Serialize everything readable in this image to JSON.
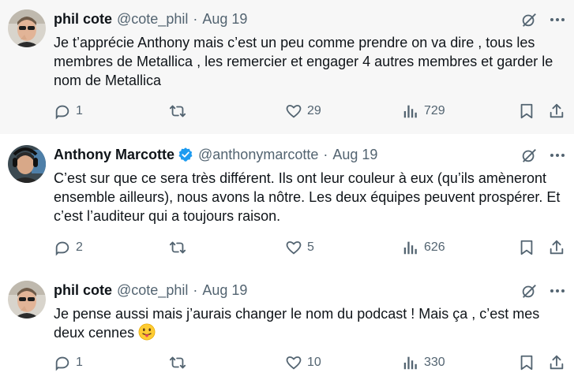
{
  "tweets": [
    {
      "name": "phil cote",
      "handle": "@cote_phil",
      "separator": "·",
      "date": "Aug 19",
      "text": "Je t’apprécie Anthony mais c’est un peu comme prendre on va dire , tous les membres de Metallica , les remercier et engager 4 autres membres et garder le nom de Metallica",
      "replies": "1",
      "retweets": "",
      "likes": "29",
      "views": "729"
    },
    {
      "name": "Anthony Marcotte",
      "handle": "@anthonymarcotte",
      "separator": "·",
      "date": "Aug 19",
      "text": "C’est sur que ce sera très différent. Ils ont leur couleur à eux (qu’ils amèneront ensemble ailleurs), nous avons la nôtre. Les deux équipes peuvent prospérer. Et c’est l’auditeur qui a toujours raison.",
      "replies": "2",
      "retweets": "",
      "likes": "5",
      "views": "626"
    },
    {
      "name": "phil cote",
      "handle": "@cote_phil",
      "separator": "·",
      "date": "Aug 19",
      "text": "Je pense aussi mais j’aurais changer le nom du podcast ! Mais ça , c’est mes deux cennes",
      "emoji": "😛",
      "replies": "1",
      "retweets": "",
      "likes": "10",
      "views": "330"
    }
  ],
  "icons": {
    "reply": "reply-icon",
    "retweet": "retweet-icon",
    "like": "heart-icon",
    "views": "views-icon",
    "bookmark": "bookmark-icon",
    "share": "share-icon",
    "grok": "grok-icon",
    "more": "more-icon",
    "verified": "verified-badge-icon"
  },
  "colors": {
    "text": "#0f1419",
    "secondary": "#536471",
    "verified": "#1d9bf0",
    "highlight_bg": "#f7f7f7",
    "thread_line": "#cfd9de"
  }
}
